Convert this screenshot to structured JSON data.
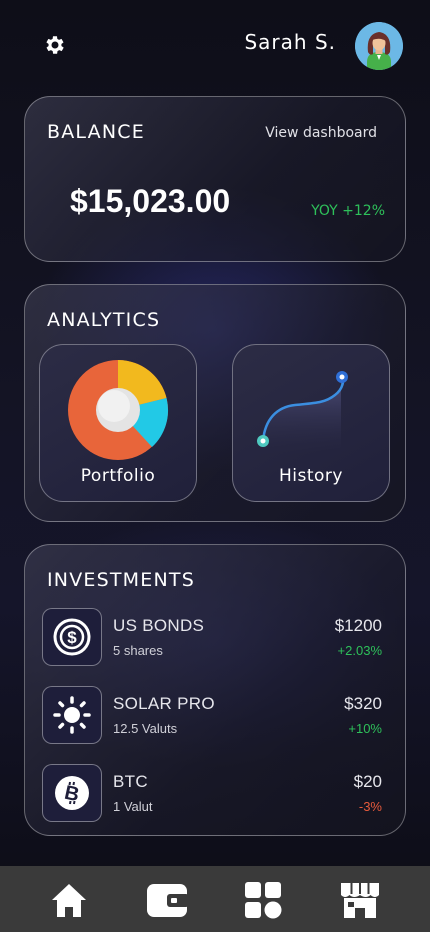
{
  "header": {
    "username": "Sarah S.",
    "settings_icon": "gear-icon",
    "avatar_icon": "user-avatar"
  },
  "balance": {
    "title": "BALANCE",
    "view_link": "View dashboard",
    "amount": "$15,023.00",
    "yoy": "YOY +12%",
    "yoy_color": "#2ec05a"
  },
  "analytics": {
    "title": "ANALYTICS",
    "tiles": [
      {
        "label": "Portfolio",
        "icon": "donut-chart-icon"
      },
      {
        "label": "History",
        "icon": "line-chart-icon"
      }
    ]
  },
  "investments": {
    "title": "INVESTMENTS",
    "items": [
      {
        "name": "US BONDS",
        "sub": "5 shares",
        "price": "$1200",
        "change": "+2.03%",
        "trend": "up",
        "icon": "dollar-coin-icon"
      },
      {
        "name": "SOLAR PRO",
        "sub": "12.5 Valuts",
        "price": "$320",
        "change": "+10%",
        "trend": "up",
        "icon": "sun-icon"
      },
      {
        "name": "BTC",
        "sub": "1 Valut",
        "price": "$20",
        "change": "-3%",
        "trend": "down",
        "icon": "bitcoin-icon"
      }
    ]
  },
  "navbar": {
    "items": [
      "home-icon",
      "wallet-icon",
      "apps-icon",
      "store-icon"
    ]
  },
  "colors": {
    "positive": "#2ec05a",
    "negative": "#e65a3c",
    "pie_orange": "#e8653a",
    "pie_yellow": "#f2b91e",
    "pie_cyan": "#22c9e6",
    "history_line": "#3b8ee0"
  }
}
